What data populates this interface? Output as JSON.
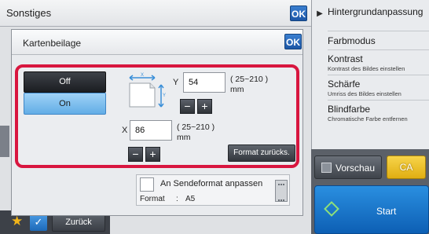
{
  "window": {
    "title": "Sonstiges",
    "ok_label": "OK"
  },
  "right_panel": {
    "header": "Hintergrundanpassung",
    "items": [
      {
        "title": "Farbmodus",
        "subtitle": ""
      },
      {
        "title": "Kontrast",
        "subtitle": "Kontrast des Bildes einstellen"
      },
      {
        "title": "Schärfe",
        "subtitle": "Umriss des Bildes einstellen"
      },
      {
        "title": "Blindfarbe",
        "subtitle": "Chromatische Farbe entfernen"
      }
    ],
    "preview_label": "Vorschau",
    "ca_label": "CA",
    "start_label": "Start"
  },
  "bottom_bar": {
    "back_label": "Zurück"
  },
  "dialog": {
    "title": "Kartenbeilage",
    "ok_label": "OK",
    "off_label": "Off",
    "on_label": "On",
    "selected": "On",
    "y_label": "Y",
    "y_value": "54",
    "y_range": "( 25~210 )",
    "y_unit": "mm",
    "x_label": "X",
    "x_value": "86",
    "x_range": "( 25~210 )",
    "x_unit": "mm",
    "minus_label": "−",
    "plus_label": "+",
    "reset_label": "Format zurücks.",
    "adapt_label": "An Sendeformat anpassen",
    "format_label": "Format",
    "format_sep": ":",
    "format_value": "A5"
  },
  "colors": {
    "accent_blue": "#1c56a6",
    "selection_red": "#d8163f",
    "on_selected": "#62ade6",
    "ca_yellow": "#e0ae12"
  }
}
